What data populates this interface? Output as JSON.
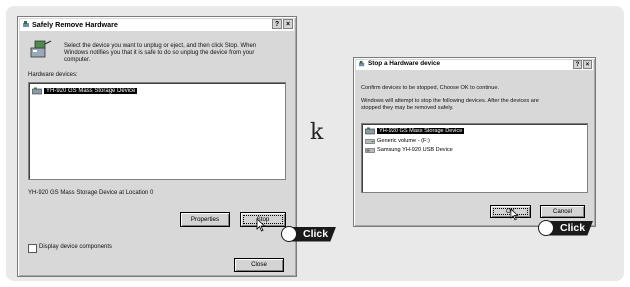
{
  "stray_char": "k",
  "click_label": "Click",
  "left_dialog": {
    "title": "Safely Remove Hardware",
    "title_buttons": [
      "?",
      "×"
    ],
    "instruction_lines": [
      "Select the device you want to unplug or eject, and then click Stop. When",
      "Windows notifies you that it is safe to do so unplug the device from your",
      "computer."
    ],
    "devices_label": "Hardware devices:",
    "devices": [
      "YH-920 GS Mass Storage Device"
    ],
    "location_text": "YH-920 GS Mass Storage Device at Location 0",
    "properties_button": "Properties",
    "stop_button": "Stop",
    "checkbox_label": "Display device components",
    "close_button": "Close"
  },
  "right_dialog": {
    "title": "Stop a Hardware device",
    "title_buttons": [
      "?",
      "×"
    ],
    "confirm_text": "Confirm devices to be stopped, Choose OK to continue.",
    "attempt_lines": [
      "Windows will attempt to stop the following devices. After the devices are",
      "stopped they may be removed safely."
    ],
    "devices": [
      "YH-920 GS Mass Storage Device",
      "Generic volume - (F:)",
      "Samsung YH-920 USB Device"
    ],
    "ok_button": "OK",
    "cancel_button": "Cancel"
  }
}
